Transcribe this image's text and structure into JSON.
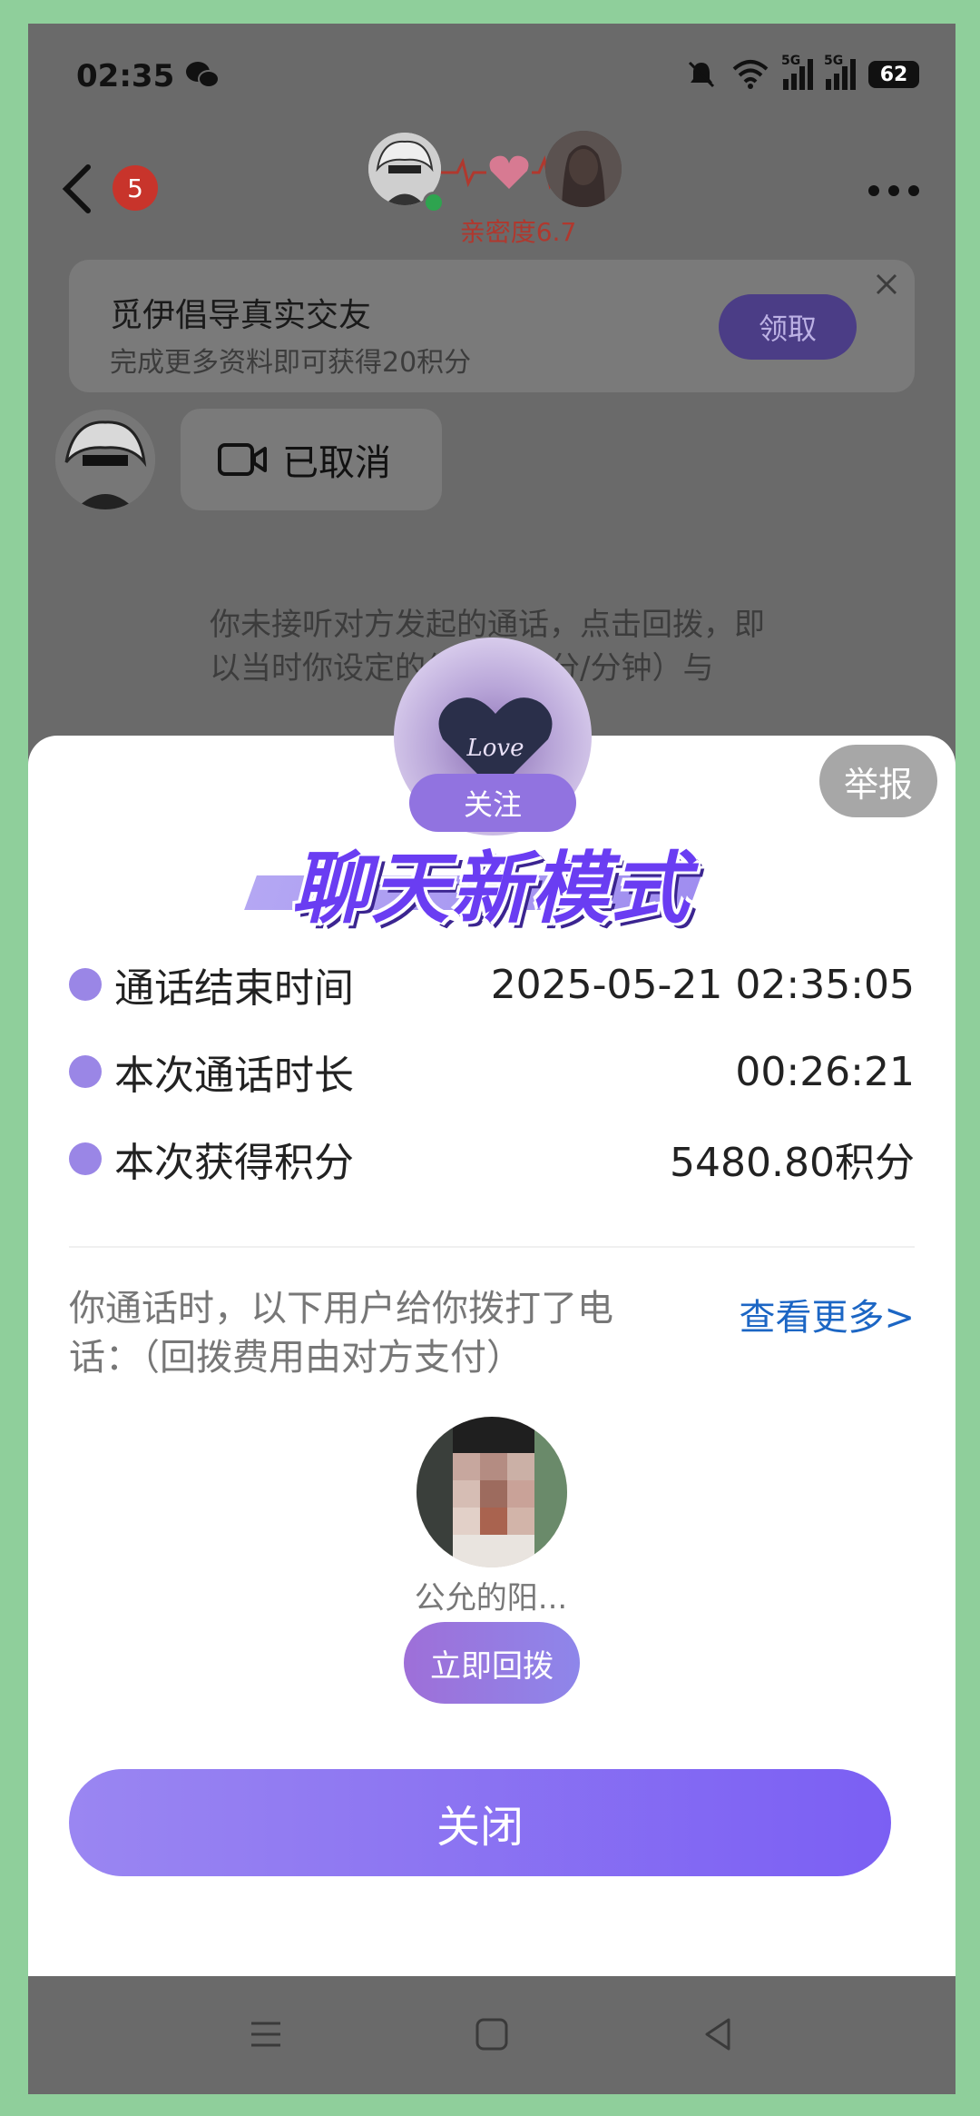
{
  "status_bar": {
    "time": "02:35",
    "battery": "62",
    "network_1": "5G",
    "network_2": "5G"
  },
  "header": {
    "unread_count": "5",
    "intimacy": "亲密度6.7"
  },
  "promo": {
    "title": "觅伊倡导真实交友",
    "subtitle": "完成更多资料即可获得20积分",
    "claim_label": "领取"
  },
  "messages": {
    "call_status": "已取消",
    "system_note": "你未接听对方发起的通话，点击回拨，即以当时你设定的价格（积分/分钟）与"
  },
  "sheet": {
    "report_label": "举报",
    "follow_label": "关注",
    "headline": "聊天新模式",
    "rows": [
      {
        "label": "通话结束时间",
        "value": "2025-05-21 02:35:05",
        "icon": "clock-icon"
      },
      {
        "label": "本次通话时长",
        "value": "00:26:21",
        "icon": "stopwatch-icon"
      },
      {
        "label": "本次获得积分",
        "value": "5480.80积分",
        "icon": "money-bag-icon"
      }
    ],
    "callers_text": "你通话时，以下用户给你拨打了电话：（回拨费用由对方支付）",
    "see_more": "查看更多>",
    "caller_name": "公允的阳...",
    "callback_label": "立即回拨",
    "close_label": "关闭"
  },
  "colors": {
    "accent": "#7b5ff3",
    "link": "#1c66c4",
    "headline": "#6a3df2",
    "icon": "#9a86e6",
    "frame": "#8fcf9b"
  },
  "avatar_text": "Love"
}
